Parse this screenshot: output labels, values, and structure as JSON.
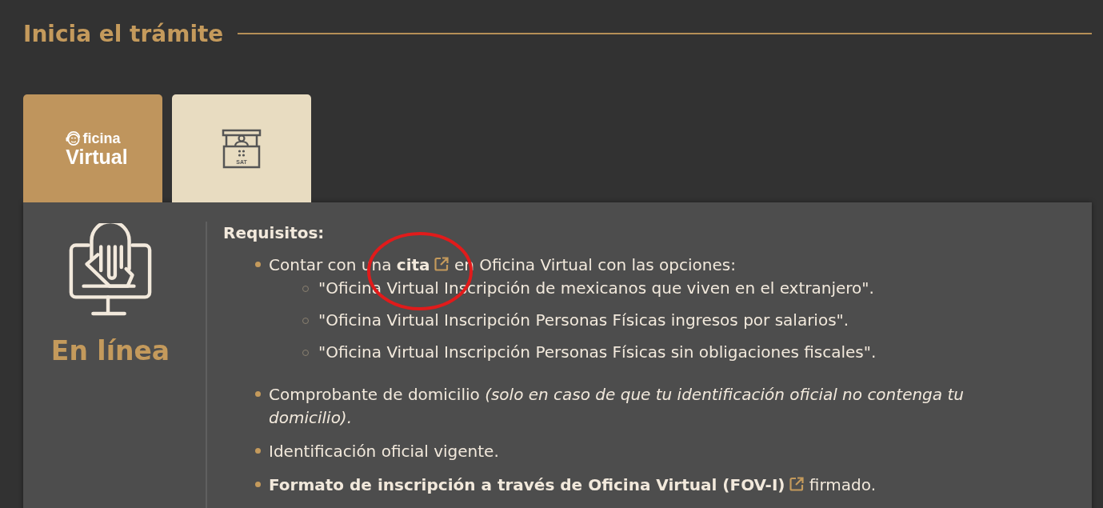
{
  "heading": "Inicia el trámite",
  "tabs": [
    {
      "kind": "oficina-virtual",
      "logo_small": "ficina",
      "logo_large": "Virtual",
      "selected": true
    },
    {
      "kind": "kiosk",
      "logo_small": "SAT",
      "selected": false
    }
  ],
  "panel": {
    "mode_label": "En línea",
    "title": "Requisitos:",
    "items": [
      {
        "segments": [
          {
            "kind": "text",
            "text": "Contar con una "
          },
          {
            "kind": "link",
            "text": "cita",
            "highlighted": true
          },
          {
            "kind": "text",
            "text": " en Oficina Virtual con las opciones:"
          }
        ],
        "children": [
          {
            "text": "\"Oficina Virtual Inscripción de mexicanos que viven en el extranjero\"."
          },
          {
            "text": "\"Oficina Virtual Inscripción Personas Físicas ingresos por salarios\"."
          },
          {
            "text": "\"Oficina Virtual Inscripción Personas Físicas sin obligaciones fiscales\"."
          }
        ]
      },
      {
        "segments": [
          {
            "kind": "text",
            "text": "Comprobante de domicilio *(solo en caso de que tu identificación oficial no contenga tu domicilio).*"
          }
        ]
      },
      {
        "segments": [
          {
            "kind": "text",
            "text": "Identificación oficial vigente."
          }
        ]
      },
      {
        "segments": [
          {
            "kind": "link",
            "text": "Formato de inscripción a través de Oficina Virtual (FOV-I)"
          },
          {
            "kind": "text",
            "text": " firmado."
          }
        ]
      }
    ]
  }
}
